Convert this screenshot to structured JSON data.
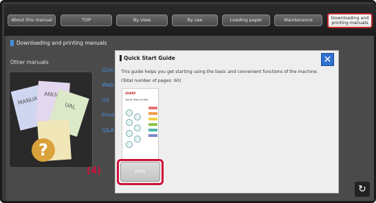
{
  "tabs": [
    {
      "label": "About this manual"
    },
    {
      "label": "TOP"
    },
    {
      "label": "By view"
    },
    {
      "label": "By use"
    },
    {
      "label": "Loading paper"
    },
    {
      "label": "Maintenance"
    },
    {
      "label": "Downloading and printing manuals"
    }
  ],
  "page": {
    "section_title": "Downloading and printing manuals",
    "other_manuals": "Other manuals",
    "links": [
      "Quic",
      "Web",
      "U/I",
      "Print",
      "Q&A"
    ]
  },
  "dialog": {
    "title": "Quick Start Guide",
    "close": "✕",
    "description": "This guide helps you get starting using the basic and convenient functions of the machine.",
    "pages": "(Total number of pages: 60)",
    "thumb_brand": "SHARP",
    "thumb_title": "Quick Start Guide",
    "print_button": "Print"
  },
  "annotation": {
    "step_label": "(4)",
    "color": "#d0103a"
  },
  "reload_icon": "reload-icon"
}
